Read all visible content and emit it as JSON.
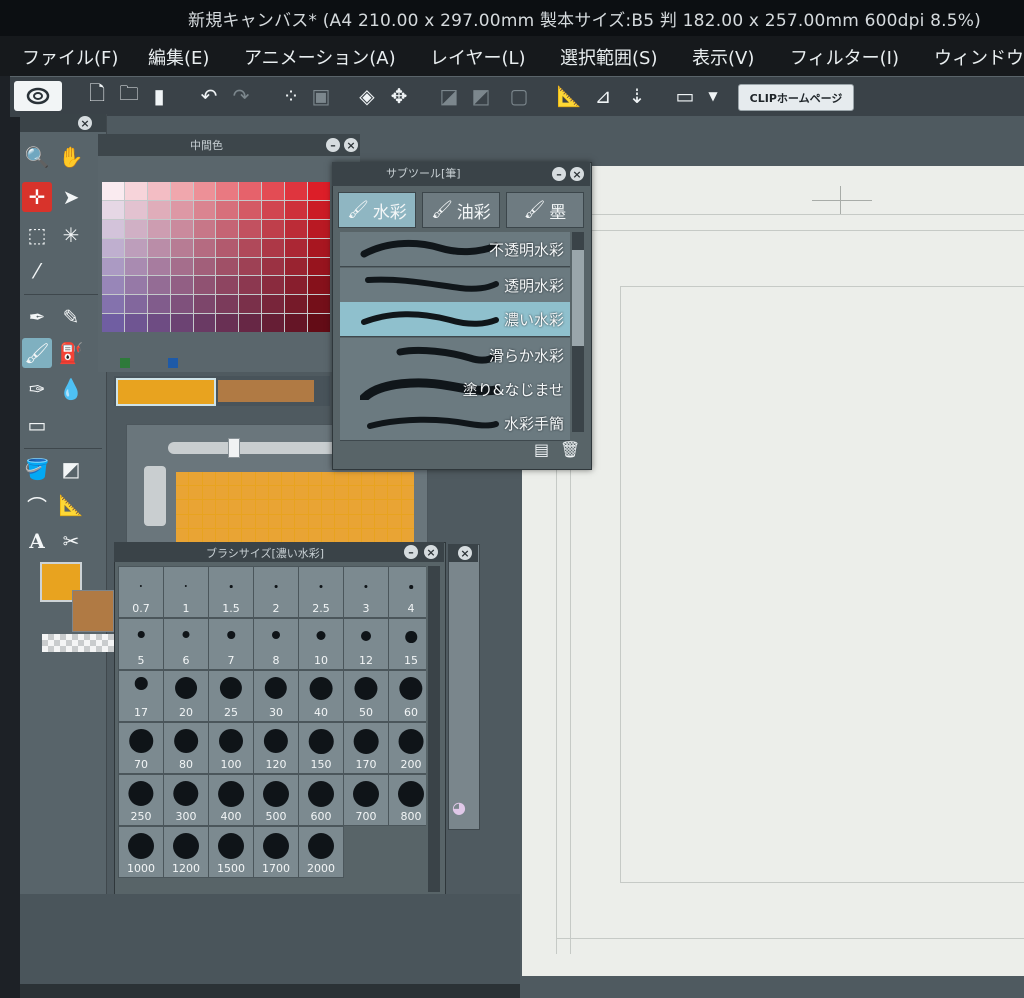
{
  "window": {
    "title": "新規キャンバス* (A4 210.00 x 297.00mm 製本サイズ:B5 判 182.00 x 257.00mm 600dpi 8.5%)"
  },
  "menu": {
    "items": [
      "ファイル(F)",
      "編集(E)",
      "アニメーション(A)",
      "レイヤー(L)",
      "選択範囲(S)",
      "表示(V)",
      "フィルター(I)",
      "ウィンドウ"
    ]
  },
  "command_bar": {
    "clip_button_label": "CLIPホームページ"
  },
  "color_palette": {
    "title": "中間色"
  },
  "sub_tool": {
    "title": "サブツール[筆]",
    "tabs": [
      {
        "label": "水彩",
        "active": true
      },
      {
        "label": "油彩",
        "active": false
      },
      {
        "label": "墨",
        "active": false
      }
    ],
    "brushes": [
      {
        "label": "不透明水彩",
        "active": false
      },
      {
        "label": "透明水彩",
        "active": false
      },
      {
        "label": "濃い水彩",
        "active": true
      },
      {
        "label": "滑らか水彩",
        "active": false
      },
      {
        "label": "塗り&なじませ",
        "active": false
      },
      {
        "label": "水彩手簡",
        "active": false
      }
    ]
  },
  "brush_size": {
    "title": "ブラシサイズ[濃い水彩]",
    "sizes": [
      "0.7",
      "1",
      "1.5",
      "2",
      "2.5",
      "3",
      "4",
      "5",
      "6",
      "7",
      "8",
      "10",
      "12",
      "15",
      "17",
      "20",
      "25",
      "30",
      "40",
      "50",
      "60",
      "70",
      "80",
      "100",
      "120",
      "150",
      "170",
      "200",
      "250",
      "300",
      "400",
      "500",
      "600",
      "700",
      "800",
      "1000",
      "1200",
      "1500",
      "1700",
      "2000"
    ]
  },
  "colors": {
    "main": "#e8a31f",
    "sub": "#b07a44",
    "accent": "#8fc0cd"
  }
}
